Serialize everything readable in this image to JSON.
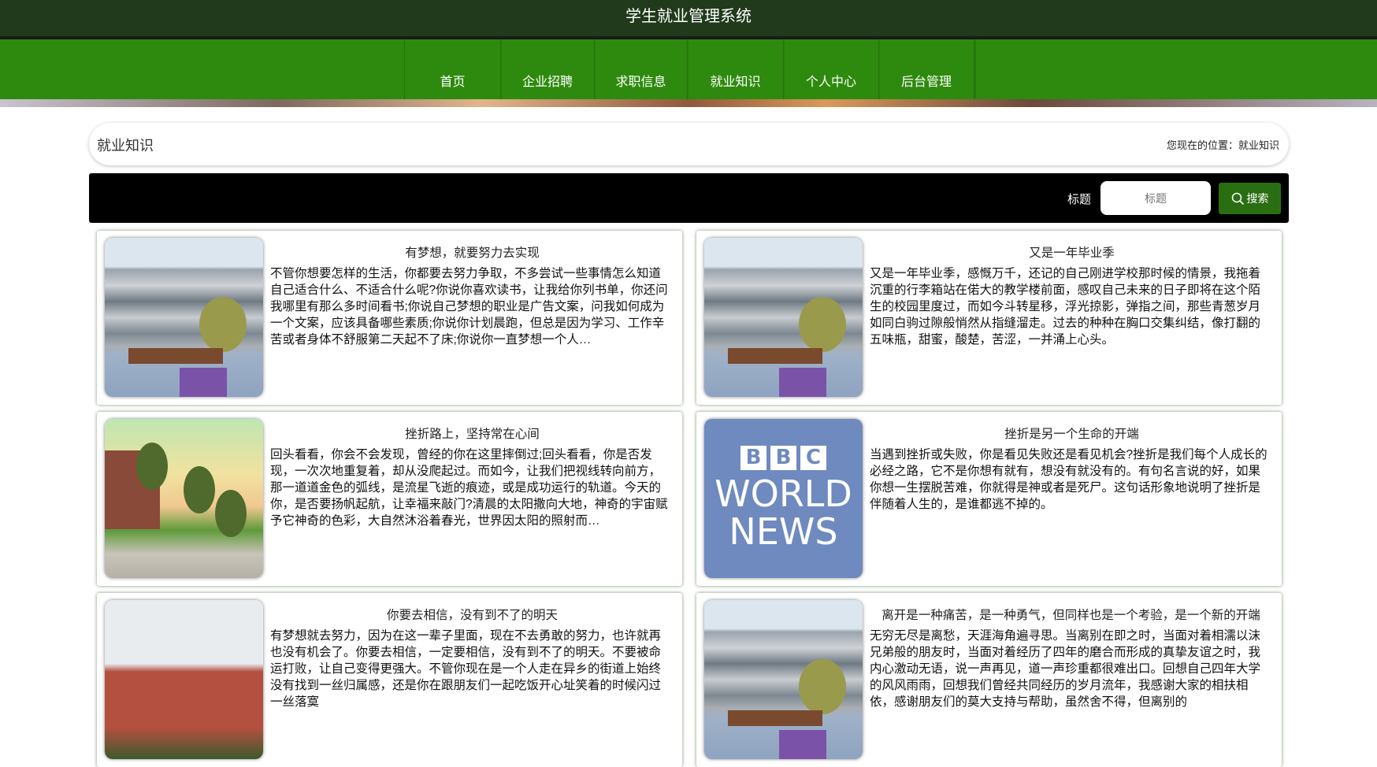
{
  "header": {
    "title": "学生就业管理系统"
  },
  "nav": {
    "items": [
      {
        "label": "首页"
      },
      {
        "label": "企业招聘"
      },
      {
        "label": "求职信息"
      },
      {
        "label": "就业知识"
      },
      {
        "label": "个人中心"
      },
      {
        "label": "后台管理"
      }
    ]
  },
  "breadcrumb": {
    "title": "就业知识",
    "location": "您现在的位置：就业知识"
  },
  "search": {
    "label": "标题",
    "placeholder": "标题",
    "button": "搜索"
  },
  "articles": [
    {
      "title": "有梦想，就要努力去实现",
      "body": "不管你想要怎样的生活，你都要去努力争取，不多尝试一些事情怎么知道自己适合什么、不适合什么呢?你说你喜欢读书，让我给你列书单，你还问我哪里有那么多时间看书;你说自己梦想的职业是广告文案，问我如何成为一个文案，应该具备哪些素质;你说你计划晨跑，但总是因为学习、工作辛苦或者身体不舒服第二天起不了床;你说你一直梦想一个人…",
      "image": "school-courtyard"
    },
    {
      "title": "又是一年毕业季",
      "body": "又是一年毕业季，感慨万千，还记的自己刚进学校那时候的情景，我拖着沉重的行李箱站在偌大的教学楼前面，感叹自己未来的日子即将在这个陌生的校园里度过，而如今斗转星移，浮光掠影，弹指之间，那些青葱岁月如同白驹过隙般悄然从指缝溜走。过去的种种在胸口交集纠结，像打翻的五味瓶，甜蜜，酸楚，苦涩，一并涌上心头。",
      "image": "school-courtyard"
    },
    {
      "title": "挫折路上，坚持常在心间",
      "body": "回头看看，你会不会发现，曾经的你在这里摔倒过;回头看看，你是否发现，一次次地重复着，却从没爬起过。而如今，让我们把视线转向前方，那一道道金色的弧线，是流星飞逝的痕迹，或是成功运行的轨道。今天的你，是否要扬帆起航，让幸福来敲门?清晨的太阳撒向大地，神奇的宇宙赋予它神奇的色彩，大自然沐浴着春光，世界因太阳的照射而…",
      "image": "campus-road"
    },
    {
      "title": "挫折是另一个生命的开端",
      "body": "当遇到挫折或失败，你是看见失败还是看见机会?挫折是我们每个人成长的必经之路，它不是你想有就有，想没有就没有的。有句名言说的好，如果你想一生摆脱苦难，你就得是神或者是死尸。这句话形象地说明了挫折是伴随着人生的，是谁都逃不掉的。",
      "image": "bbc-world-news",
      "logo": {
        "line1": [
          "B",
          "B",
          "C"
        ],
        "line2": "WORLD",
        "line3": "NEWS"
      }
    },
    {
      "title": "你要去相信，没有到不了的明天",
      "body": "有梦想就去努力，因为在这一辈子里面，现在不去勇敢的努力，也许就再也没有机会了。你要去相信，一定要相信，没有到不了的明天。不要被命运打败，让自己变得更强大。不管你现在是一个人走在异乡的街道上始终没有找到一丝归属感，还是你在跟朋友们一起吃饭开心址笑着的时候闪过一丝落寞",
      "image": "school-building"
    },
    {
      "title": "离开是一种痛苦，是一种勇气，但同样也是一个考验，是一个新的开端",
      "body": "无穷无尽是离愁，天涯海角遍寻思。当离别在即之时，当面对着相濡以沫兄弟般的朋友时，当面对着经历了四年的磨合而形成的真挚友谊之时，我内心激动无语，说一声再见，道一声珍重都很难出口。回想自己四年大学的风风雨雨，回想我们曾经共同经历的岁月流年，我感谢大家的相扶相依，感谢朋友们的莫大支持与帮助，虽然舍不得，但离别的",
      "image": "school-courtyard"
    }
  ],
  "colors": {
    "header": "#203a1b",
    "nav": "#2e8a0e",
    "search_button": "#2a6e12"
  }
}
